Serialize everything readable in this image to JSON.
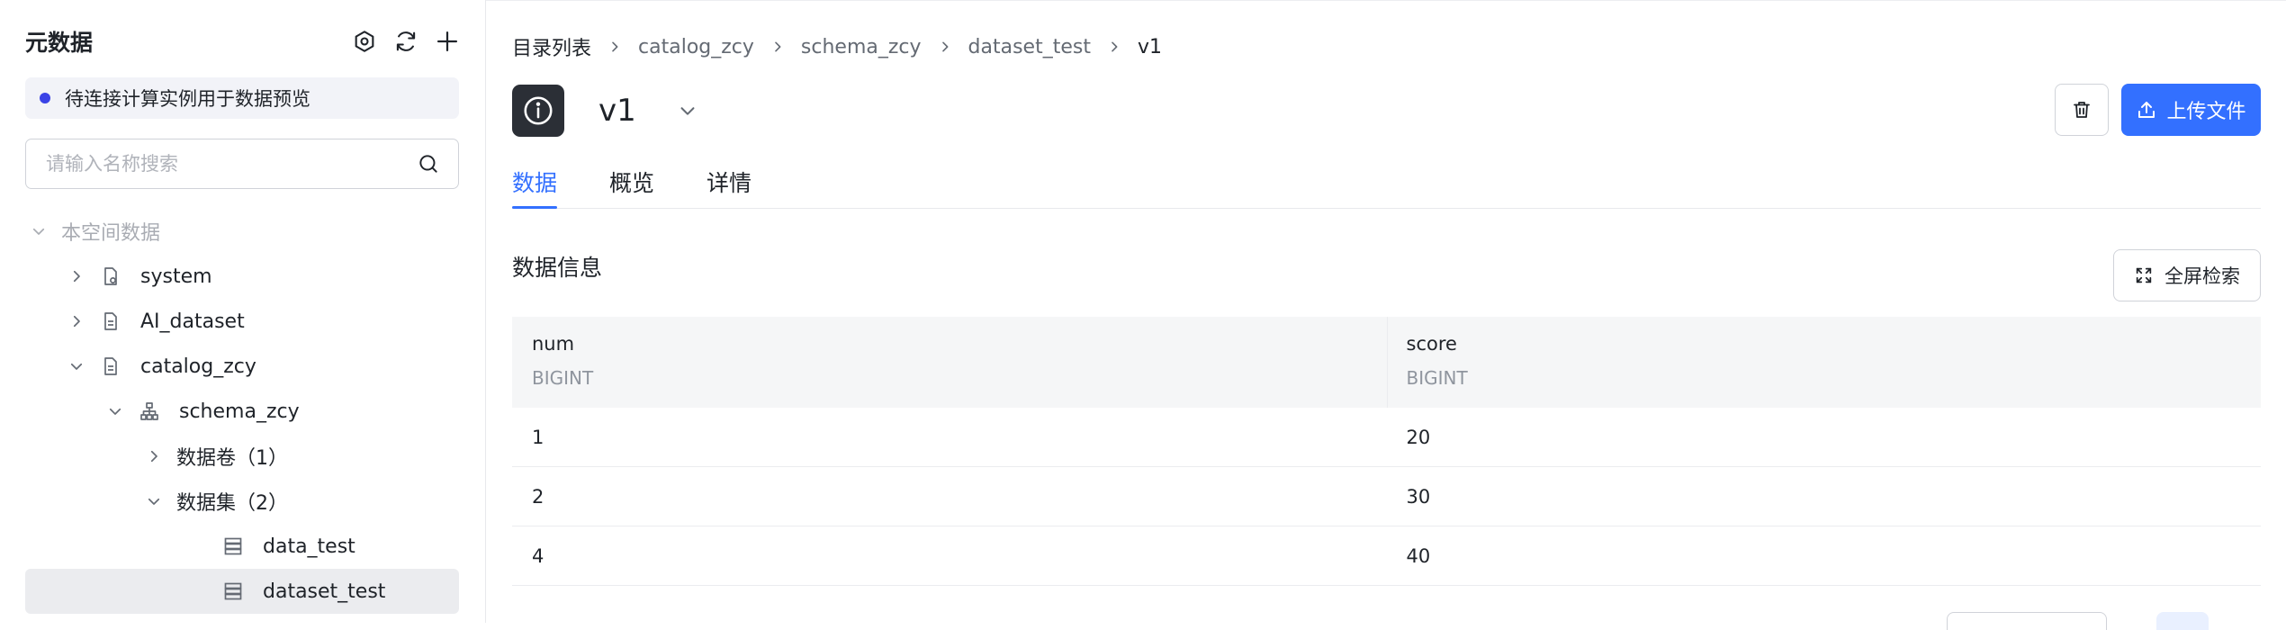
{
  "sidebar": {
    "title": "元数据",
    "actions": {
      "settings_icon": "hexagon-settings-icon",
      "refresh_icon": "refresh-icon",
      "add_icon": "plus-icon"
    },
    "status": {
      "text": "待连接计算实例用于数据预览",
      "dot_color": "#3a43e6"
    },
    "search": {
      "placeholder": "请输入名称搜索",
      "value": ""
    },
    "tree": {
      "root_label": "本空间数据",
      "items": [
        {
          "label": "system",
          "icon": "document-gear-icon",
          "expanded": false
        },
        {
          "label": "AI_dataset",
          "icon": "document-icon",
          "expanded": false
        },
        {
          "label": "catalog_zcy",
          "icon": "document-icon",
          "expanded": true
        },
        {
          "label": "schema_zcy",
          "icon": "schema-hierarchy-icon",
          "expanded": true
        },
        {
          "label": "数据卷（1）",
          "expanded": false
        },
        {
          "label": "数据集（2）",
          "expanded": true
        },
        {
          "label": "data_test",
          "icon": "table-stack-icon"
        },
        {
          "label": "dataset_test",
          "icon": "table-stack-icon",
          "selected": true
        }
      ]
    }
  },
  "breadcrumb": [
    "目录列表",
    "catalog_zcy",
    "schema_zcy",
    "dataset_test",
    "v1"
  ],
  "header": {
    "title": "v1",
    "badge_icon": "info-icon",
    "delete_icon": "trash-icon",
    "upload_label": "上传文件",
    "upload_icon": "upload-icon",
    "accent_color": "#3370ff"
  },
  "tabs": [
    {
      "label": "数据",
      "active": true
    },
    {
      "label": "概览",
      "active": false
    },
    {
      "label": "详情",
      "active": false
    }
  ],
  "section": {
    "title": "数据信息",
    "fullscreen_label": "全屏检索",
    "fullscreen_icon": "expand-icon"
  },
  "table": {
    "columns": [
      {
        "name": "num",
        "type": "BIGINT"
      },
      {
        "name": "score",
        "type": "BIGINT"
      }
    ],
    "rows": [
      [
        "1",
        "20"
      ],
      [
        "2",
        "30"
      ],
      [
        "4",
        "40"
      ]
    ]
  }
}
